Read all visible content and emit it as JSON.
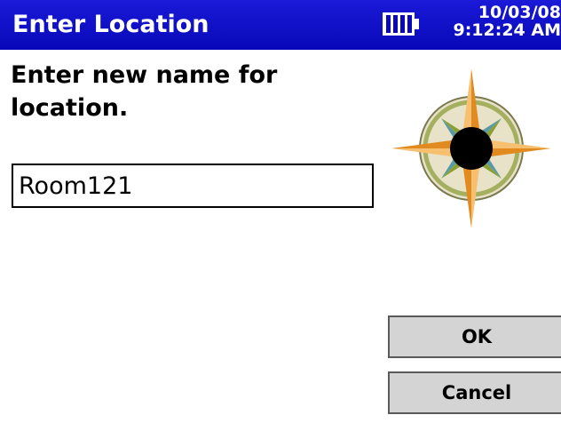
{
  "title_bar": {
    "title": "Enter Location",
    "battery_icon": "battery-icon",
    "date": "10/03/08",
    "time": "9:12:24 AM"
  },
  "form": {
    "prompt": "Enter new name for location.",
    "location_name_value": "Room121",
    "compass_icon": "compass-rose-icon"
  },
  "buttons": {
    "ok_label": "OK",
    "cancel_label": "Cancel"
  },
  "colors": {
    "title_bar_bg": "#0a0ac0",
    "button_bg": "#d4d4d4",
    "compass_orange": "#f0a030",
    "compass_teal": "#5a9aa8",
    "compass_green": "#8aa030"
  }
}
